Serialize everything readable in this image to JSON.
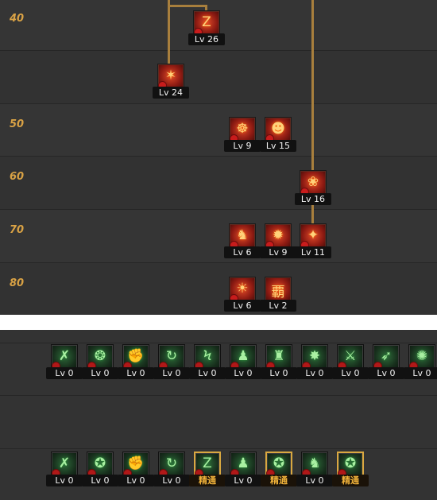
{
  "tree": {
    "level_rows": [
      "40",
      "",
      "50",
      "60",
      "70",
      "80"
    ],
    "skills": [
      {
        "id": "s26",
        "level": "Lv 26",
        "icon": "lightning-zigzag-icon",
        "glyph": "Z"
      },
      {
        "id": "s24",
        "level": "Lv 24",
        "icon": "fire-beast-icon",
        "glyph": "✶"
      },
      {
        "id": "s9a",
        "level": "Lv 9",
        "icon": "flame-demon-icon",
        "glyph": "☸"
      },
      {
        "id": "s15",
        "level": "Lv 15",
        "icon": "shadow-figure-icon",
        "glyph": "☻"
      },
      {
        "id": "s16",
        "level": "Lv 16",
        "icon": "fire-dragon-icon",
        "glyph": "❀"
      },
      {
        "id": "s6a",
        "level": "Lv 6",
        "icon": "green-warrior-icon",
        "glyph": "♞"
      },
      {
        "id": "s9b",
        "level": "Lv 9",
        "icon": "fire-burst-icon",
        "glyph": "✹"
      },
      {
        "id": "s11",
        "level": "Lv 11",
        "icon": "flame-strike-icon",
        "glyph": "✦"
      },
      {
        "id": "s6b",
        "level": "Lv 6",
        "icon": "fire-orb-icon",
        "glyph": "☀"
      },
      {
        "id": "s2",
        "level": "Lv 2",
        "icon": "awakening-kanji-icon",
        "glyph": "覇"
      }
    ]
  },
  "lower": {
    "row1": [
      {
        "level": "Lv 0",
        "icon": "dark-slash-icon",
        "glyph": "✗"
      },
      {
        "level": "Lv 0",
        "icon": "energy-wave-icon",
        "glyph": "❂"
      },
      {
        "level": "Lv 0",
        "icon": "fist-punch-icon",
        "glyph": "✊"
      },
      {
        "level": "Lv 0",
        "icon": "spin-kick-icon",
        "glyph": "↻"
      },
      {
        "level": "Lv 0",
        "icon": "chain-lightning-icon",
        "glyph": "Ϟ"
      },
      {
        "level": "Lv 0",
        "icon": "fighter-stance-icon",
        "glyph": "♟"
      },
      {
        "level": "Lv 0",
        "icon": "muscle-body-icon",
        "glyph": "♜"
      },
      {
        "level": "Lv 0",
        "icon": "explosion-icon",
        "glyph": "✸"
      },
      {
        "level": "Lv 0",
        "icon": "green-blade-icon",
        "glyph": "⚔"
      },
      {
        "level": "Lv 0",
        "icon": "dash-strike-icon",
        "glyph": "➶"
      },
      {
        "level": "Lv 0",
        "icon": "whirlwind-icon",
        "glyph": "✺"
      }
    ],
    "row2": [
      {
        "level": "Lv 0",
        "icon": "dark-slash-icon",
        "glyph": "✗",
        "gold": false
      },
      {
        "level": "Lv 0",
        "icon": "ex-kick-icon",
        "glyph": "✪",
        "gold": false
      },
      {
        "level": "Lv 0",
        "icon": "fist-punch-icon",
        "glyph": "✊",
        "gold": false
      },
      {
        "level": "Lv 0",
        "icon": "spin-kick-icon",
        "glyph": "↻",
        "gold": false
      },
      {
        "level": "精通",
        "icon": "lightning-zigzag-icon",
        "glyph": "Z",
        "gold": true
      },
      {
        "level": "Lv 0",
        "icon": "fighter-stance-icon",
        "glyph": "♟",
        "gold": false
      },
      {
        "level": "精通",
        "icon": "ex-grapple-icon",
        "glyph": "✪",
        "gold": true
      },
      {
        "level": "Lv 0",
        "icon": "green-warrior-icon",
        "glyph": "♞",
        "gold": false
      },
      {
        "level": "精通",
        "icon": "ex-dash-icon",
        "glyph": "✪",
        "gold": true
      }
    ]
  }
}
